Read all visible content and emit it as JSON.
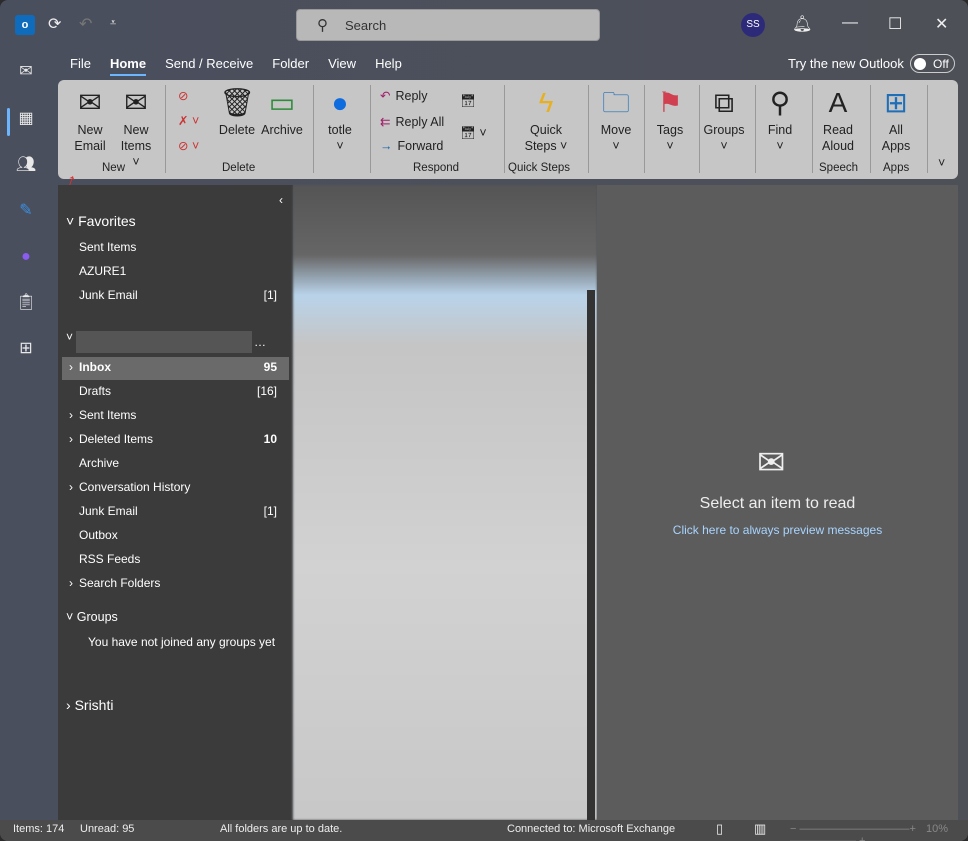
{
  "titlebar": {
    "search_placeholder": "Search",
    "avatar_initials": "SS"
  },
  "menu_tabs": [
    "File",
    "Home",
    "Send / Receive",
    "Folder",
    "View",
    "Help"
  ],
  "try_new": {
    "label": "Try the new Outlook",
    "toggle": "Off"
  },
  "ribbon": {
    "new_email": [
      "New",
      "Email"
    ],
    "new_items": [
      "New",
      "Items ˅"
    ],
    "group_new": "New",
    "delete": "Delete",
    "archive": "Archive",
    "group_delete": "Delete",
    "totle": "totle",
    "reply": "Reply",
    "reply_all": "Reply All",
    "forward": "Forward",
    "group_respond": "Respond",
    "quick_steps": [
      "Quick",
      "Steps ˅"
    ],
    "group_quick_steps": "Quick Steps",
    "move": "Move",
    "tags": "Tags",
    "groups": "Groups",
    "find": "Find",
    "read_aloud": [
      "Read",
      "Aloud"
    ],
    "group_speech": "Speech",
    "all_apps": [
      "All",
      "Apps"
    ],
    "group_apps": "Apps"
  },
  "favorites": {
    "title": "Favorites",
    "items": [
      {
        "label": "Sent Items",
        "count": ""
      },
      {
        "label": "AZURE1",
        "count": ""
      },
      {
        "label": "Junk Email",
        "count": "[1]"
      }
    ]
  },
  "account": {
    "items": [
      {
        "label": "Inbox",
        "count": "95",
        "expand": true
      },
      {
        "label": "Drafts",
        "count": "[16]"
      },
      {
        "label": "Sent Items",
        "count": "",
        "expand": true
      },
      {
        "label": "Deleted Items",
        "count": "10",
        "expand": true
      },
      {
        "label": "Archive",
        "count": ""
      },
      {
        "label": "Conversation History",
        "count": "",
        "expand": true
      },
      {
        "label": "Junk Email",
        "count": "[1]"
      },
      {
        "label": "Outbox",
        "count": ""
      },
      {
        "label": "RSS Feeds",
        "count": ""
      },
      {
        "label": "Search Folders",
        "count": "",
        "expand": true
      }
    ]
  },
  "groups": {
    "title": "Groups",
    "empty": "You have not joined any groups yet"
  },
  "srishti": "Srishti",
  "reading": {
    "title": "Select an item to read",
    "link": "Click here to always preview messages"
  },
  "status": {
    "items": "Items: 174",
    "unread": "Unread: 95",
    "sync": "All folders are up to date.",
    "connection": "Connected to: Microsoft Exchange",
    "zoom": "10%"
  }
}
